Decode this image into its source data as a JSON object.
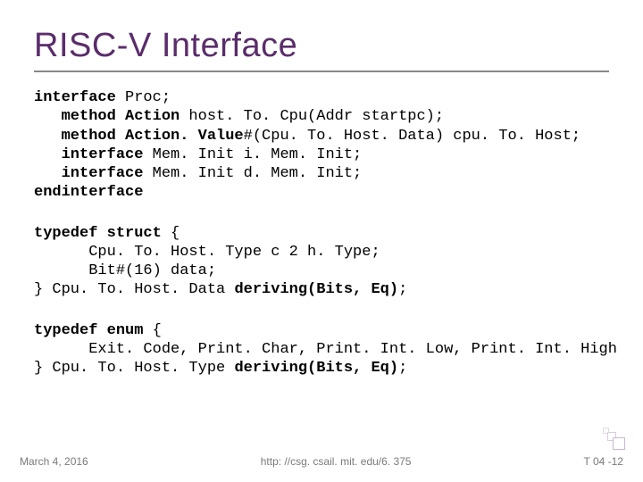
{
  "title": "RISC-V Interface",
  "code": {
    "block1": {
      "l1a": "interface",
      "l1b": " Proc;",
      "l2a": "   method Action",
      "l2b": " host. To. Cpu(Addr startpc);",
      "l3a": "   method Action. Value",
      "l3b": "#(Cpu. To. Host. Data) cpu. To. Host;",
      "l4a": "   interface",
      "l4b": " Mem. Init i. Mem. Init;",
      "l5a": "   interface",
      "l5b": " Mem. Init d. Mem. Init;",
      "l6a": "endinterface"
    },
    "block2": {
      "l1a": "typedef struct",
      "l1b": " {",
      "l2": "      Cpu. To. Host. Type c 2 h. Type;",
      "l3": "      Bit#(16) data;",
      "l4a": "} Cpu. To. Host. Data ",
      "l4b": "deriving(Bits, Eq)",
      "l4c": ";"
    },
    "block3": {
      "l1a": "typedef enum",
      "l1b": " {",
      "l2": "      Exit. Code, Print. Char, Print. Int. Low, Print. Int. High",
      "l3a": "} Cpu. To. Host. Type ",
      "l3b": "deriving(Bits, Eq)",
      "l3c": ";"
    }
  },
  "footer": {
    "left": "March 4, 2016",
    "center": "http: //csg. csail. mit. edu/6. 375",
    "right": "T 04 -12"
  }
}
